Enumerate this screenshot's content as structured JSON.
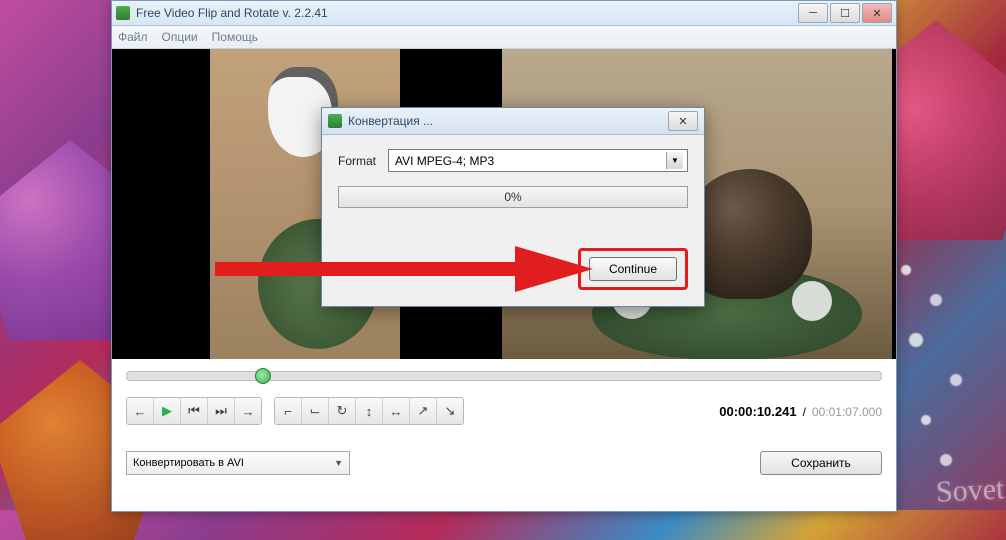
{
  "app": {
    "title": "Free Video Flip and Rotate v. 2.2.41"
  },
  "menu": {
    "file": "Файл",
    "options": "Опции",
    "help": "Помощь"
  },
  "playback": {
    "current_time": "00:00:10.241",
    "total_time": "00:01:07.000",
    "separator": "/"
  },
  "output": {
    "format_selected": "Конвертировать в AVI",
    "save_label": "Сохранить"
  },
  "dialog": {
    "title": "Конвертация ...",
    "format_label": "Format",
    "format_value": "AVI MPEG-4; MP3",
    "progress_text": "0%",
    "continue_label": "Continue"
  },
  "watermark": "Sovet"
}
